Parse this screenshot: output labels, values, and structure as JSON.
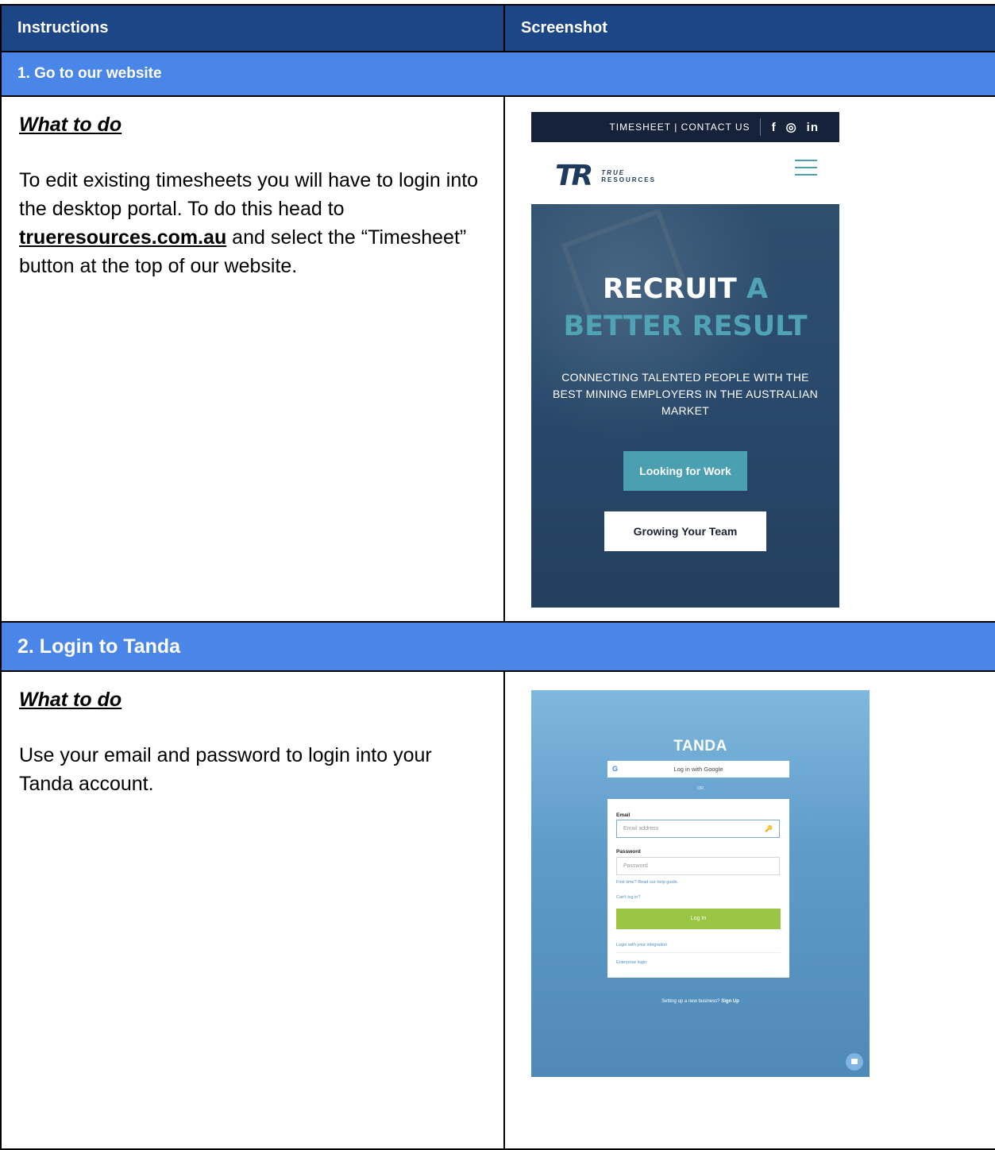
{
  "table": {
    "header_left": "Instructions",
    "header_right": "Screenshot"
  },
  "sections": [
    {
      "title": "1. Go to our website",
      "what_to_do": "What to do",
      "text_before": "To edit existing timesheets you will have to login into the desktop portal. To do this head to ",
      "link": "trueresources.com.au",
      "text_after": " and select the “Timesheet” button at the top of our website."
    },
    {
      "title": "2. Login to Tanda",
      "what_to_do": "What to do",
      "text": "Use your email and password to login into your Tanda account."
    }
  ],
  "shot1": {
    "topbar_links": "TIMESHEET  |  CONTACT US",
    "social": [
      "f",
      "◎",
      "in"
    ],
    "logo_mark": "TR",
    "logo_name_1": "TRUE",
    "logo_name_2": "RESOURCES",
    "hero_line1_white": "RECRUIT",
    "hero_line1_teal": "A",
    "hero_line2": "BETTER RESULT",
    "subtitle": "CONNECTING TALENTED PEOPLE WITH THE BEST MINING EMPLOYERS IN THE AUSTRALIAN MARKET",
    "btn_primary": "Looking for Work",
    "btn_secondary": "Growing Your Team",
    "colors": {
      "topbar": "#16213a",
      "teal": "#4a9fb0",
      "hero": "#2a4a6c"
    }
  },
  "shot2": {
    "logo": "TANDA",
    "google_btn": "Log in with Google",
    "google_icon": "G",
    "or": "OR",
    "email_label": "Email",
    "email_placeholder": "Email address",
    "password_label": "Password",
    "password_placeholder": "Password",
    "help_link": "First time? Read our help guide.",
    "cant_login": "Can't log in?",
    "login_btn": "Log In",
    "integration_link": "Login with your integration",
    "enterprise_link": "Enterprise login",
    "signup_text": "Setting up a new business?",
    "signup_link": "Sign Up",
    "colors": {
      "login_btn": "#9bc544",
      "link": "#4f8fc2"
    }
  }
}
